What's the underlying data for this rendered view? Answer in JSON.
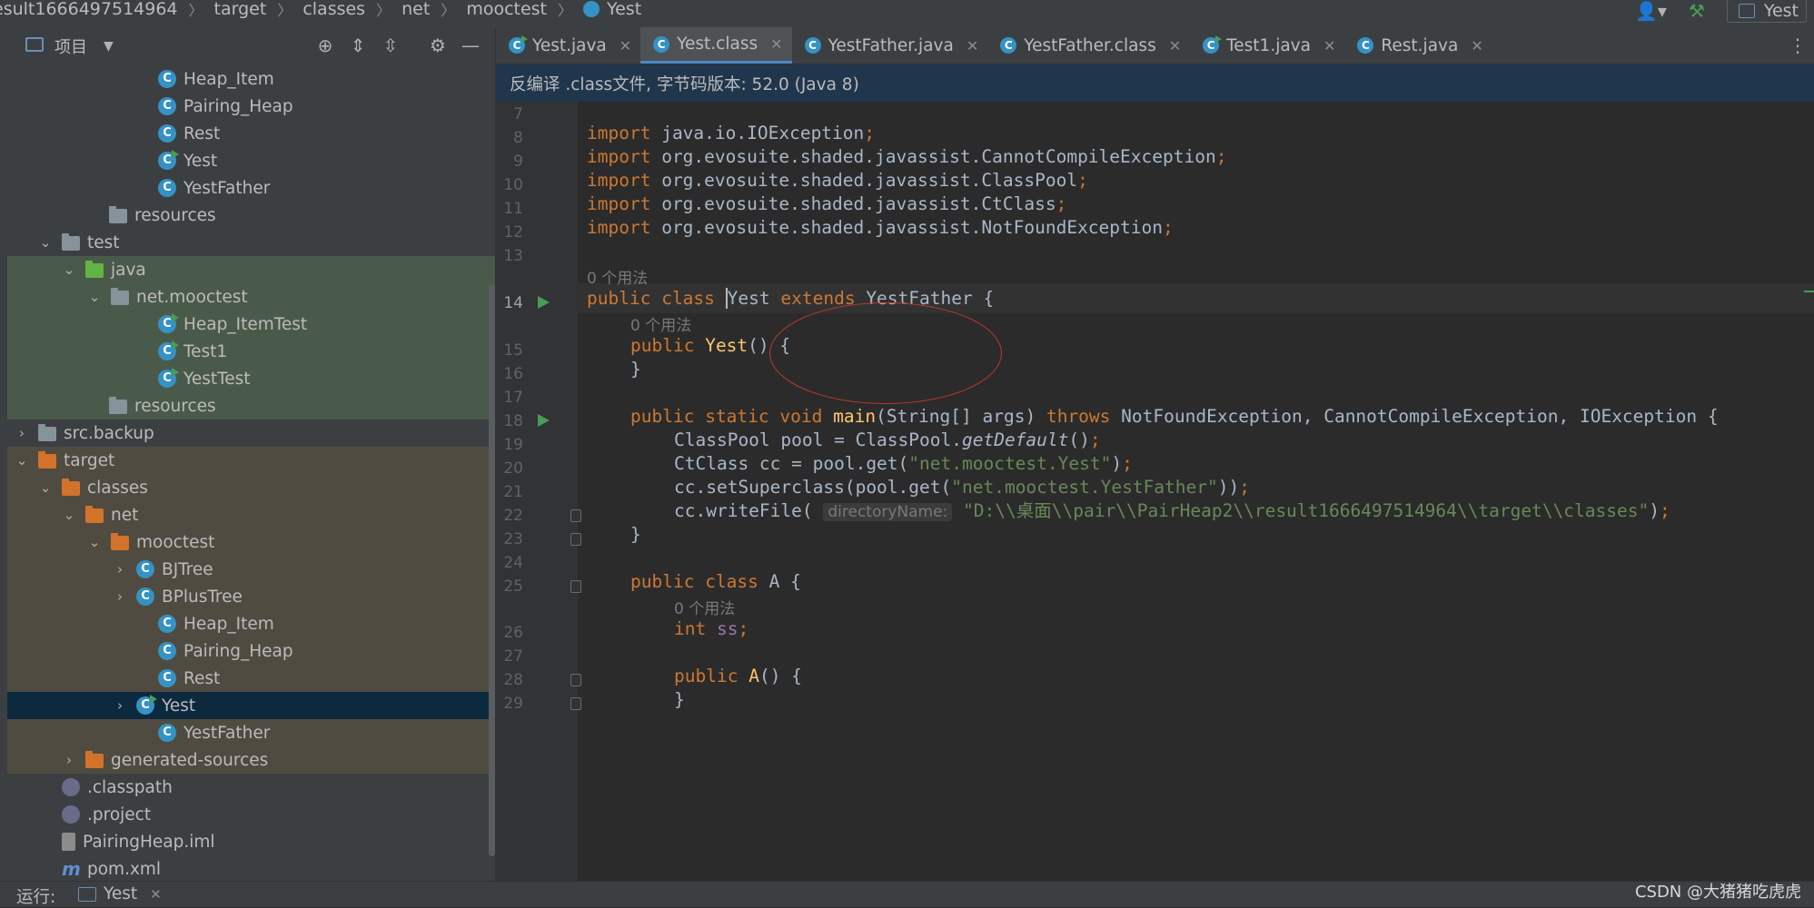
{
  "breadcrumb": {
    "items": [
      "esult1666497514964",
      "target",
      "classes",
      "net",
      "mooctest"
    ],
    "current": "Yest",
    "run_config": "Yest"
  },
  "project_panel": {
    "title": "项目",
    "tree": [
      {
        "label": "Heap_Item",
        "icon": "class-icon",
        "bg": ""
      },
      {
        "label": "Pairing_Heap",
        "icon": "class-icon",
        "bg": ""
      },
      {
        "label": "Rest",
        "icon": "class-icon",
        "bg": ""
      },
      {
        "label": "Yest",
        "icon": "class-run-icon",
        "bg": ""
      },
      {
        "label": "YestFather",
        "icon": "class-icon",
        "bg": ""
      },
      {
        "label": "resources",
        "icon": "resources-folder-icon",
        "bg": ""
      },
      {
        "label": "test",
        "icon": "folder-icon",
        "bg": "",
        "arrow": "open"
      },
      {
        "label": "java",
        "icon": "test-folder-icon",
        "bg": "green",
        "arrow": "open"
      },
      {
        "label": "net.mooctest",
        "icon": "package-icon",
        "bg": "green",
        "arrow": "open"
      },
      {
        "label": "Heap_ItemTest",
        "icon": "class-run-icon",
        "bg": "green"
      },
      {
        "label": "Test1",
        "icon": "class-run-icon",
        "bg": "green"
      },
      {
        "label": "YestTest",
        "icon": "class-run-icon",
        "bg": "green"
      },
      {
        "label": "resources",
        "icon": "test-resources-folder-icon",
        "bg": "green"
      },
      {
        "label": "src.backup",
        "icon": "folder-icon",
        "bg": "",
        "arrow": "closed"
      },
      {
        "label": "target",
        "icon": "excluded-folder-icon",
        "bg": "brown",
        "arrow": "open"
      },
      {
        "label": "classes",
        "icon": "excluded-folder-icon",
        "bg": "brown",
        "arrow": "open"
      },
      {
        "label": "net",
        "icon": "excluded-folder-icon",
        "bg": "brown",
        "arrow": "open"
      },
      {
        "label": "mooctest",
        "icon": "excluded-folder-icon",
        "bg": "brown",
        "arrow": "open"
      },
      {
        "label": "BJTree",
        "icon": "class-icon",
        "bg": "brown",
        "arrow": "closed"
      },
      {
        "label": "BPlusTree",
        "icon": "class-icon",
        "bg": "brown",
        "arrow": "closed"
      },
      {
        "label": "Heap_Item",
        "icon": "class-icon",
        "bg": "brown"
      },
      {
        "label": "Pairing_Heap",
        "icon": "class-icon",
        "bg": "brown"
      },
      {
        "label": "Rest",
        "icon": "class-icon",
        "bg": "brown"
      },
      {
        "label": "Yest",
        "icon": "class-run-icon",
        "bg": "selected",
        "arrow": "closed"
      },
      {
        "label": "YestFather",
        "icon": "class-icon",
        "bg": "brown"
      },
      {
        "label": "generated-sources",
        "icon": "excluded-folder-icon",
        "bg": "brown",
        "arrow": "closed"
      },
      {
        "label": ".classpath",
        "icon": "eclipse-file-icon",
        "bg": ""
      },
      {
        "label": ".project",
        "icon": "eclipse-file-icon",
        "bg": ""
      },
      {
        "label": "PairingHeap.iml",
        "icon": "iml-file-icon",
        "bg": ""
      },
      {
        "label": "pom.xml",
        "icon": "maven-file-icon",
        "bg": ""
      }
    ]
  },
  "tabs": [
    {
      "label": "Yest.java",
      "active": false,
      "run": true
    },
    {
      "label": "Yest.class",
      "active": true,
      "run": false
    },
    {
      "label": "YestFather.java",
      "active": false,
      "run": false
    },
    {
      "label": "YestFather.class",
      "active": false,
      "run": false
    },
    {
      "label": "Test1.java",
      "active": false,
      "run": true
    },
    {
      "label": "Rest.java",
      "active": false,
      "run": false
    }
  ],
  "banner": "反编译 .class文件, 字节码版本: 52.0 (Java 8)",
  "line_numbers": [
    "7",
    "8",
    "9",
    "10",
    "11",
    "12",
    "13",
    "14",
    "15",
    "16",
    "17",
    "18",
    "19",
    "20",
    "21",
    "22",
    "23",
    "24",
    "25",
    "26",
    "27",
    "28",
    "29"
  ],
  "usage_hint": "0 个用法",
  "inlay_param": "directoryName:",
  "code": {
    "import": "import",
    "imports": [
      "java.io.IOException",
      "org.evosuite.shaded.javassist.CannotCompileException",
      "org.evosuite.shaded.javassist.ClassPool",
      "org.evosuite.shaded.javassist.CtClass",
      "org.evosuite.shaded.javassist.NotFoundException"
    ],
    "public": "public",
    "class": "class",
    "class_name": "Yest",
    "extends": "extends",
    "super_name": "YestFather",
    "static": "static",
    "void": "void",
    "main": "main",
    "main_params": "(String[] args)",
    "throws": "throws",
    "exceptions": "NotFoundException, CannotCompileException, IOException",
    "line19_a": "ClassPool pool = ClassPool.",
    "line19_b": "getDefault",
    "line20_a": "CtClass cc = pool.get(",
    "line20_str": "\"net.mooctest.Yest\"",
    "line21_a": "cc.setSuperclass(pool.get(",
    "line21_str": "\"net.mooctest.YestFather\"",
    "line22_a": "cc.writeFile(",
    "line22_s1": "\"D:\\\\",
    "line22_cn": "桌面",
    "line22_s2": "\\\\pair\\\\PairHeap2\\\\result1666497514964\\\\target\\\\classes\"",
    "inner_class": "A",
    "int": "int",
    "field": "ss"
  },
  "bottom": {
    "label": "运行:",
    "run_tab": "Yest"
  },
  "watermark": "CSDN @大猪猪吃虎虎"
}
